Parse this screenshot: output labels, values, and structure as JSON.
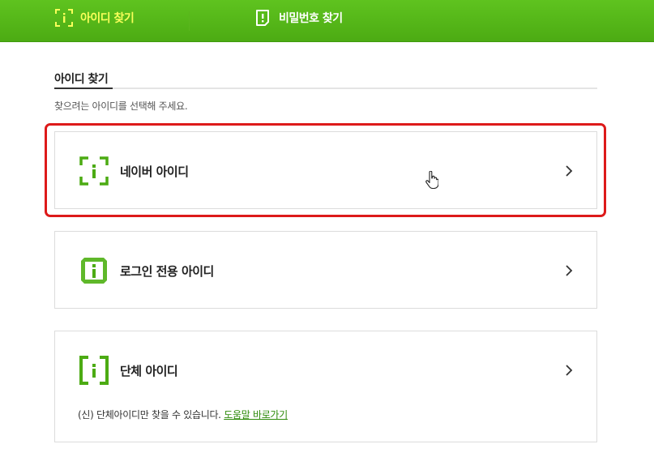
{
  "tabs": [
    {
      "label": "아이디 찾기",
      "icon": "id-scan-icon",
      "active": true
    },
    {
      "label": "비밀번호 찾기",
      "icon": "warning-lock-icon",
      "active": false
    }
  ],
  "section": {
    "title": "아이디 찾기",
    "description": "찾으려는 아이디를 선택해 주세요."
  },
  "options": [
    {
      "label": "네이버 아이디",
      "icon": "naver-id-icon",
      "highlighted": true
    },
    {
      "label": "로그인 전용 아이디",
      "icon": "login-only-id-icon",
      "highlighted": false
    },
    {
      "label": "단체 아이디",
      "icon": "group-id-icon",
      "highlighted": false,
      "note": "(신) 단체아이디만 찾을 수 있습니다.",
      "link": "도움말 바로가기"
    }
  ],
  "colors": {
    "brand_green": "#4cab13",
    "active_tab_text": "#f9ff5a",
    "highlight_red": "#dd1a1a",
    "link_green": "#2e8b0b"
  }
}
